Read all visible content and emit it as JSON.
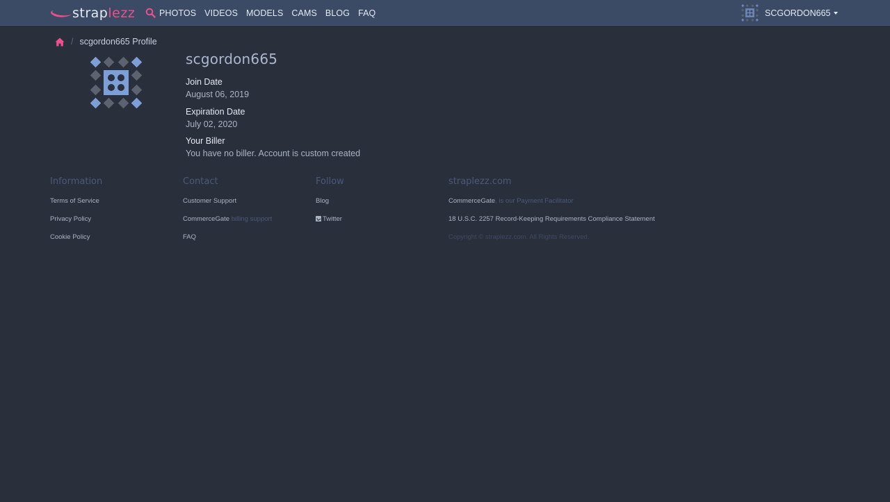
{
  "brand": {
    "name_part1": "strap",
    "name_part2": "lezz",
    "accent": "#ee4f8e",
    "header_bg": "#3b4a65",
    "page_bg": "#2a2f3c"
  },
  "nav": {
    "search_icon": "search-icon",
    "links": [
      "PHOTOS",
      "VIDEOS",
      "MODELS",
      "CAMS",
      "BLOG",
      "FAQ"
    ]
  },
  "user": {
    "name": "SCGORDON665"
  },
  "breadcrumb": {
    "home_icon": "home-icon",
    "separator": "/",
    "current": "scgordon665 Profile"
  },
  "profile": {
    "username": "scgordon665",
    "join_label": "Join Date",
    "join_value": "August 06, 2019",
    "expiration_label": "Expiration Date",
    "expiration_value": "July 02, 2020",
    "biller_label": "Your Biller",
    "biller_value": "You have no biller. Account is custom created"
  },
  "footer": {
    "information": {
      "heading": "Information",
      "links": [
        "Terms of Service",
        "Privacy Policy",
        "Cookie Policy"
      ]
    },
    "contact": {
      "heading": "Contact",
      "customer_support": "Customer Support",
      "commercegate": "CommerceGate",
      "commercegate_suffix": "billing support",
      "faq": "FAQ"
    },
    "follow": {
      "heading": "Follow",
      "blog": "Blog",
      "twitter": "Twitter"
    },
    "site": {
      "heading": "straplezz.com",
      "facilitator_name": "CommerceGate",
      "facilitator_suffix": "is our Payment Facilitator",
      "compliance": "18 U.S.C. 2257 Record-Keeping Requirements Compliance Statement",
      "copyright": "Copyright © straplezz.com. All Rights Reserved."
    }
  }
}
